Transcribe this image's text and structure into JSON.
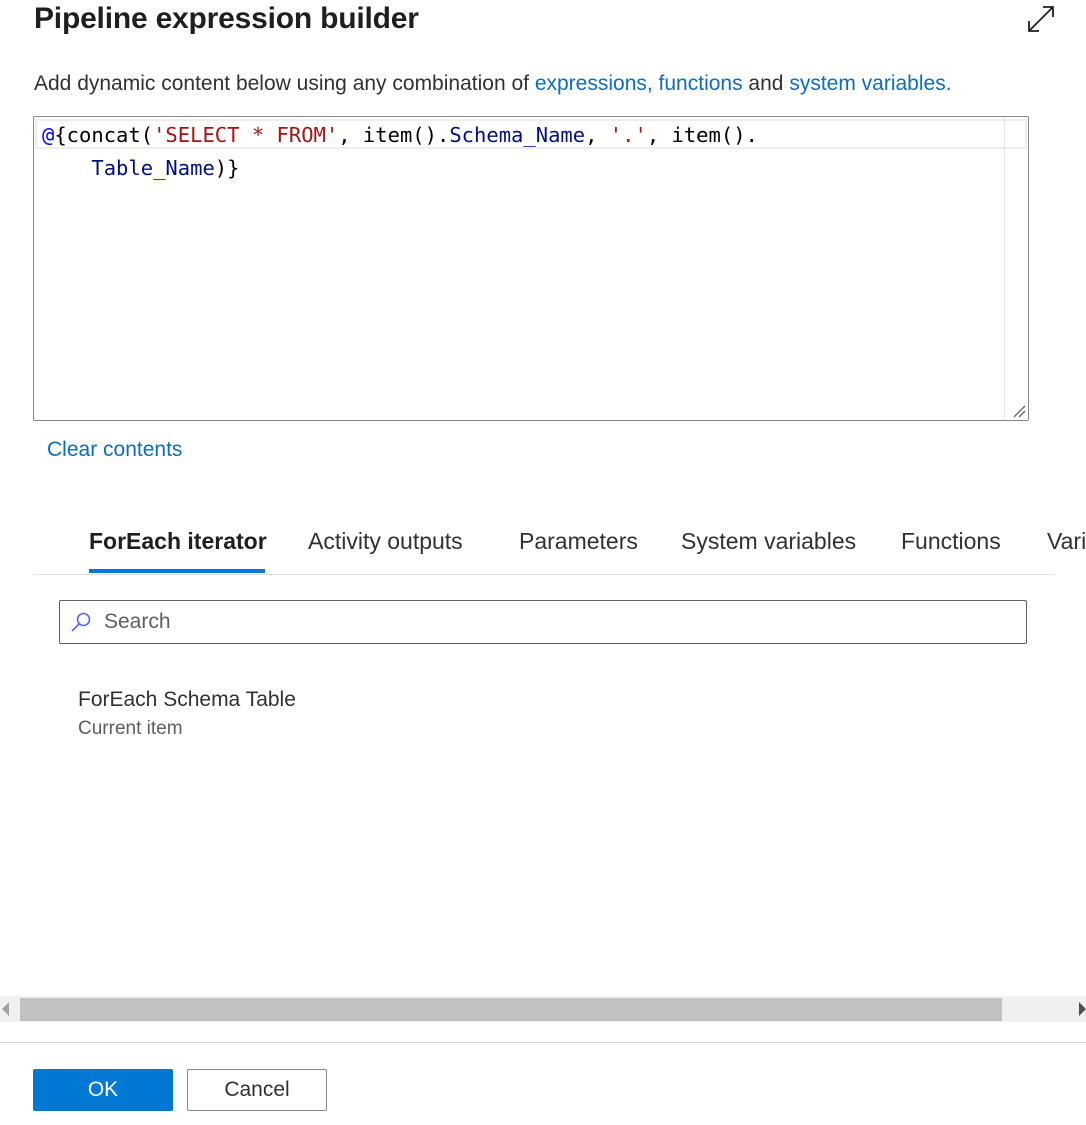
{
  "dialog": {
    "title": "Pipeline expression builder",
    "expand_icon": "expand-diagonal-icon"
  },
  "description": {
    "prefix": "Add dynamic content below using any combination of ",
    "link1": "expressions, functions",
    "middle": " and ",
    "link2": "system variables."
  },
  "editor": {
    "value": "@{concat('SELECT * FROM', item().Schema_Name, '.', item().Table_Name)}",
    "line1": {
      "at": "@",
      "t1": "{concat(",
      "s1": "'SELECT * FROM'",
      "t2": ", item().",
      "p1": "Schema_Name",
      "t3": ", ",
      "s2": "'.'",
      "t4": ", item()."
    },
    "line2": {
      "indent": "    ",
      "p2": "Table_Name",
      "t5": ")}"
    },
    "colors": {
      "at": "#0000ff",
      "string": "#a31515",
      "property": "#001080"
    }
  },
  "clear_contents": "Clear contents",
  "tabs": [
    {
      "label": "ForEach iterator",
      "active": true
    },
    {
      "label": "Activity outputs",
      "active": false
    },
    {
      "label": "Parameters",
      "active": false
    },
    {
      "label": "System variables",
      "active": false
    },
    {
      "label": "Functions",
      "active": false
    },
    {
      "label": "Vari",
      "active": false
    }
  ],
  "search": {
    "placeholder": "Search",
    "value": "",
    "icon": "search-icon"
  },
  "items": [
    {
      "name": "ForEach Schema Table",
      "subtitle": "Current item"
    }
  ],
  "footer": {
    "ok_label": "OK",
    "cancel_label": "Cancel"
  },
  "colors": {
    "accent": "#0078d4",
    "link": "#0f6cbd"
  }
}
